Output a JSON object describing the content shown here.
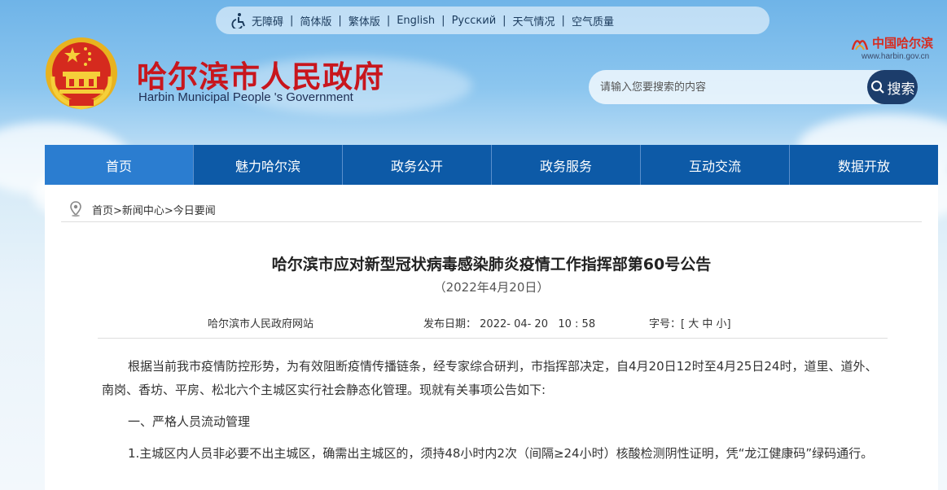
{
  "topbar": {
    "items": [
      "无障碍",
      "简体版",
      "繁体版",
      "English",
      "Русский",
      "天气情况",
      "空气质量"
    ]
  },
  "header": {
    "title": "哈尔滨市人民政府",
    "subtitle": "Harbin Municipal People 's Government",
    "logo_text": "中国哈尔滨",
    "logo_url": "www.harbin.gov.cn"
  },
  "search": {
    "placeholder": "请输入您要搜索的内容",
    "button_label": "搜索"
  },
  "nav": {
    "items": [
      "首页",
      "魅力哈尔滨",
      "政务公开",
      "政务服务",
      "互动交流",
      "数据开放"
    ]
  },
  "breadcrumb": {
    "text": "首页>新闻中心>今日要闻"
  },
  "article": {
    "title": "哈尔滨市应对新型冠状病毒感染肺炎疫情工作指挥部第60号公告",
    "date": "（2022年4月20日）",
    "source": "哈尔滨市人民政府网站",
    "publish_label": "发布日期：",
    "publish_value": "2022- 04- 20   10 : 58",
    "size_label": "字号：[",
    "size_large": "大",
    "size_medium": "中",
    "size_small": "小",
    "size_end": "]",
    "paragraphs": [
      "根据当前我市疫情防控形势，为有效阻断疫情传播链条，经专家综合研判，市指挥部决定，自4月20日12时至4月25日24时，道里、道外、南岗、香坊、平房、松北六个主城区实行社会静态化管理。现就有关事项公告如下:",
      "一、严格人员流动管理",
      "1.主城区内人员非必要不出主城区，确需出主城区的，须持48小时内2次（间隔≥24小时）核酸检测阴性证明，凭“龙江健康码”绿码通行。"
    ]
  },
  "colors": {
    "nav_bg": "#0d5aa7",
    "nav_active": "#2b7dd0",
    "title_red": "#c8161d",
    "search_btn": "#1c3d6b"
  }
}
